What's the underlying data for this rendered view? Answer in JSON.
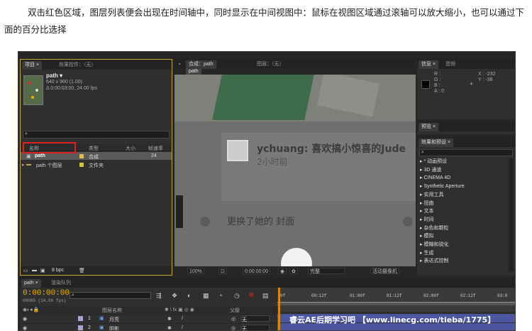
{
  "intro": {
    "text": "双击红色区域，图层列表便会出现在时间轴中，同时显示在中间视图中：鼠标在视图区域通过滚轴可以放大缩小，也可以通过下面的百分比选择"
  },
  "project_panel": {
    "tab_project": "项目 ×",
    "tab_effect_controls": "效果控件：（无）",
    "comp_name": "path ▾",
    "comp_size": "640 x 960 (1.00)",
    "comp_duration": "Δ 0:00:03:00, 24.00 fps",
    "search_placeholder": "",
    "columns": [
      "名称",
      "类型",
      "大小",
      "帧速率"
    ],
    "rows": [
      {
        "name": "path",
        "type": "合成",
        "size": "",
        "fps": "24",
        "selected": true,
        "color": "#e0c040"
      },
      {
        "name": "path 个图层",
        "type": "文件夹",
        "size": "",
        "fps": "",
        "selected": false,
        "color": "#e0c040"
      }
    ],
    "bpc": "8 bpc"
  },
  "comp_panel": {
    "tab_comp": "合成：path",
    "tab_layer": "图层：（无）",
    "breadcrumb": "path",
    "content": {
      "username": "ychuang: 喜欢搞小惊喜的Jude",
      "time": "2小时前",
      "changed": "更换了她的 封面"
    },
    "zoom": "100%",
    "timecode": "0:00:00:00",
    "resolution": "完整",
    "camera": "活动摄像机"
  },
  "info_panel": {
    "tab_info": "信息 ×",
    "tab_audio": "音频",
    "r": "R :",
    "g": "G :",
    "b": "B :",
    "a": "A : 0",
    "x": "X : -232",
    "y": "Y : -38"
  },
  "preview_panel": {
    "tab": "预览 ×"
  },
  "effects_panel": {
    "tab": "效果和预设 ×",
    "items": [
      "▸ * 动画预设",
      "▸ 3D 通道",
      "▸ CINEMA 4D",
      "▸ Synthetic Aperture",
      "▸ 实用工具",
      "▸ 扭曲",
      "▸ 文本",
      "▸ 时间",
      "▸ 杂色和颗粒",
      "▸ 模拟",
      "▸ 模糊和锐化",
      "▸ 生成",
      "▸ 表达式控制"
    ]
  },
  "timeline": {
    "tab_path": "path ×",
    "tab_render": "渲染队列",
    "timecode": "0:00:00:00",
    "timecode_sub": "00000 (24.00 fps)",
    "col_layer_name": "图层名称",
    "col_parent": "父级",
    "layers": [
      {
        "num": "1",
        "name": "月亮",
        "parent": "无"
      },
      {
        "num": "2",
        "name": "阴影",
        "parent": "无"
      }
    ],
    "ruler": [
      "00:12f",
      "01:00f",
      "01:12f",
      "02:00f",
      "02:12f",
      "03:0"
    ],
    "ruler_start": "0f"
  },
  "watermark": "睿云AE后期学习吧 【www.linecg.com/tieba/1775】",
  "colors": {
    "accent_timecode": "#e8b200",
    "highlight_box": "#e02020",
    "track": "#4b55a0"
  }
}
